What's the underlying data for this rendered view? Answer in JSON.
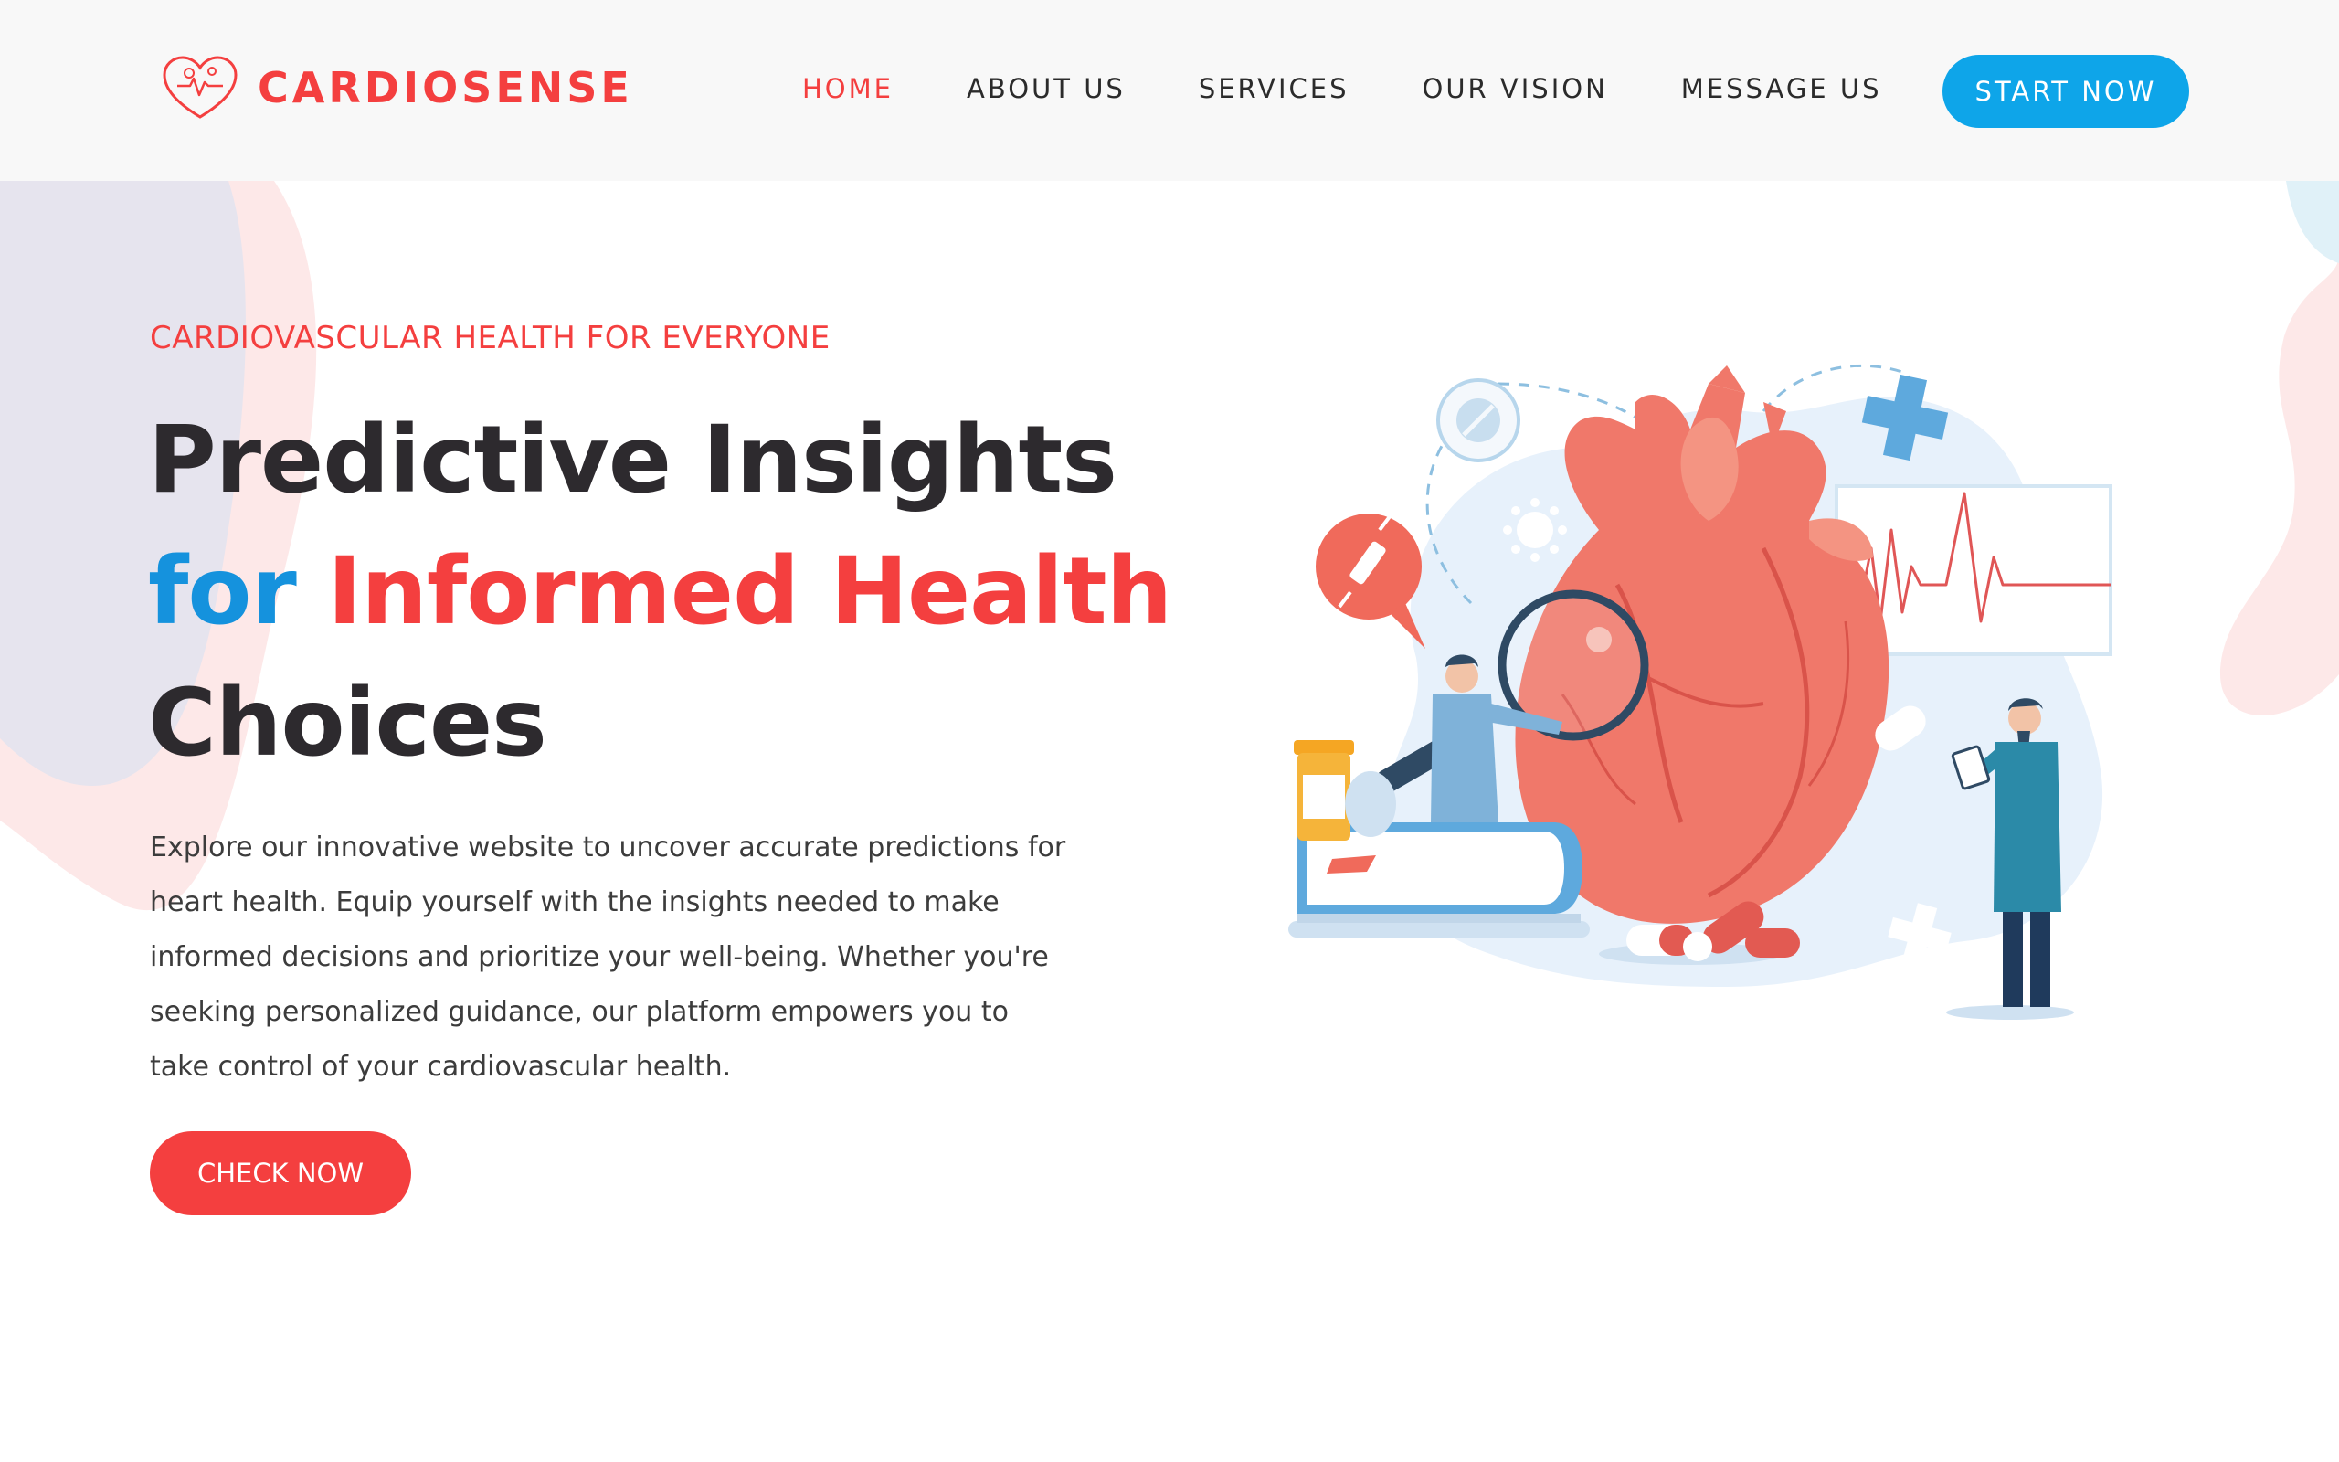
{
  "brand": {
    "name": "CARDIOSENSE",
    "color": "#f43f3f"
  },
  "nav": {
    "items": [
      {
        "label": "HOME",
        "active": true
      },
      {
        "label": "ABOUT US",
        "active": false
      },
      {
        "label": "SERVICES",
        "active": false
      },
      {
        "label": "OUR VISION",
        "active": false
      },
      {
        "label": "MESSAGE US",
        "active": false
      }
    ],
    "cta_label": "START NOW",
    "cta_color": "#0ea5e9"
  },
  "hero": {
    "kicker": "CARDIOVASCULAR HEALTH FOR EVERYONE",
    "headline": {
      "line1": "Predictive Insights",
      "line2_blue": "for",
      "line2_red": "Informed Health",
      "line3": "Choices"
    },
    "description": "Explore our innovative website to uncover accurate predictions for heart health. Equip yourself with the insights needed to make informed decisions and prioritize your well-being. Whether you're seeking personalized guidance, our platform empowers you to take control of your cardiovascular health.",
    "cta_label": "CHECK NOW",
    "cta_color": "#f43f3f"
  },
  "colors": {
    "accent_red": "#f43f3f",
    "accent_blue": "#1592dd",
    "text_dark": "#2d2a2e"
  },
  "icons": [
    "heart-logo-icon",
    "syringe-icon",
    "virus-icon",
    "pill-icon",
    "medical-cross-icon",
    "magnifier-icon",
    "clipboard-icon"
  ]
}
